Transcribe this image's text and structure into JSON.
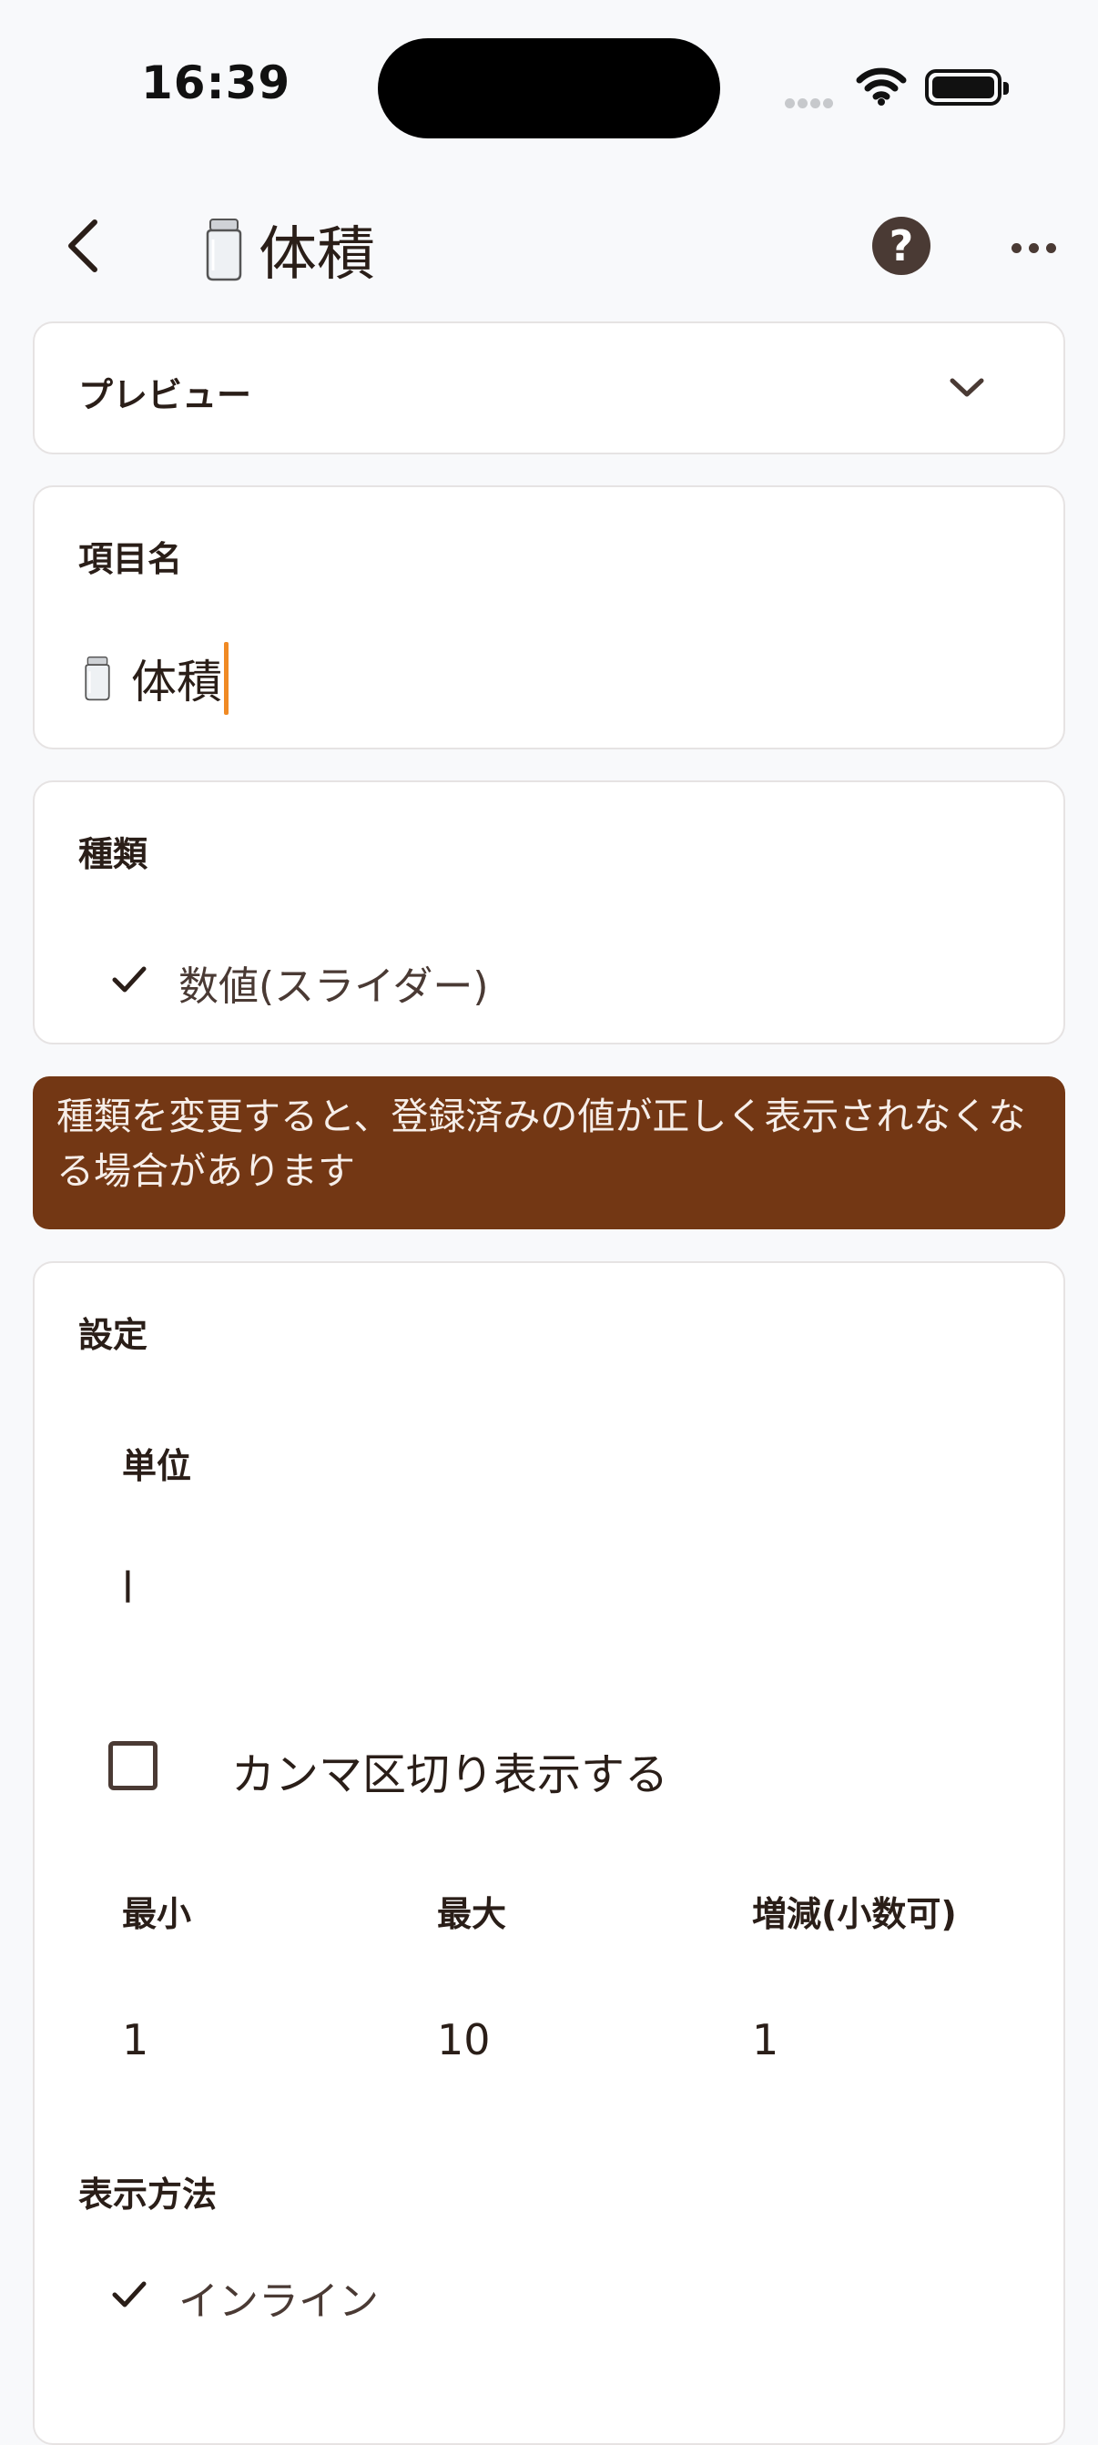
{
  "status_bar": {
    "time": "16:39"
  },
  "header": {
    "title": "体積",
    "icon": "jar-icon"
  },
  "preview": {
    "label": "プレビュー"
  },
  "item_name": {
    "label": "項目名",
    "value": "体積",
    "icon": "jar-icon"
  },
  "type": {
    "label": "種類",
    "selected": "数値(スライダー)"
  },
  "warning": {
    "text": "種類を変更すると、登録済みの値が正しく表示されなくなる場合があります"
  },
  "settings": {
    "label": "設定",
    "unit_label": "単位",
    "unit_value": "l",
    "comma_label": "カンマ区切り表示する",
    "comma_checked": false,
    "min_label": "最小",
    "max_label": "最大",
    "step_label": "増減(小数可)",
    "min_value": "1",
    "max_value": "10",
    "step_value": "1",
    "display_label": "表示方法",
    "display_selected": "インライン"
  },
  "colors": {
    "warning_bg": "#733714",
    "accent": "#f08a24",
    "text": "#2a1e18"
  }
}
